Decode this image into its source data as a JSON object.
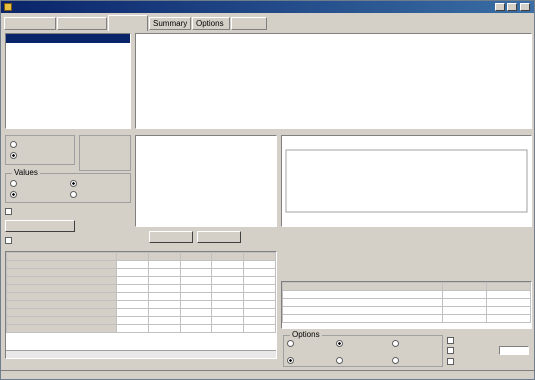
{
  "window": {
    "title": ""
  },
  "tabs": [
    {
      "label": ""
    },
    {
      "label": ""
    },
    {
      "label": ""
    },
    {
      "label": "Summary"
    },
    {
      "label": "Options"
    },
    {
      "label": ""
    }
  ],
  "person_list": [
    {
      "label": "",
      "selected": true
    },
    {
      "label": ""
    },
    {
      "label": ""
    },
    {
      "label": ""
    },
    {
      "label": ""
    },
    {
      "label": ""
    },
    {
      "label": ""
    },
    {
      "label": ""
    }
  ],
  "paragraphs": [
    "",
    "",
    "",
    "",
    "",
    "",
    "",
    "",
    "",
    "",
    "",
    "",
    "",
    "",
    "",
    ""
  ],
  "source_group": {
    "title": "",
    "option_a": "",
    "option_b": "",
    "option_b_selected": true
  },
  "data_group": {
    "title": "",
    "items": [
      "",
      "",
      "",
      ""
    ]
  },
  "results_group": {
    "title": "Values",
    "summary": "",
    "average": "",
    "average_selected": true,
    "all_data": "",
    "all_data_selected": true,
    "not_empty": ""
  },
  "percent_check": {
    "label": ""
  },
  "query_button": {
    "label": ""
  },
  "all_check": {
    "label": ""
  },
  "small_list": [
    "",
    ""
  ],
  "chart": {
    "title": "",
    "accent": "#ff0000",
    "background": "#ffffff"
  },
  "chart_data": {
    "type": "bar",
    "title": "",
    "values": [],
    "overlay_series": [],
    "xlabel": "",
    "ylabel": ""
  },
  "left_table": {
    "headers": [
      "",
      "",
      "",
      "",
      "",
      ""
    ],
    "rows": [
      {
        "label": "",
        "values": [
          "",
          "",
          "",
          "",
          ""
        ]
      },
      {
        "label": "",
        "values": [
          "",
          "",
          "",
          "",
          ""
        ]
      },
      {
        "label": "",
        "values": [
          "",
          "",
          "",
          "",
          ""
        ]
      },
      {
        "label": "",
        "values": [
          "",
          "",
          "",
          "",
          ""
        ]
      },
      {
        "label": "",
        "values": [
          "",
          "",
          "",
          "",
          ""
        ]
      },
      {
        "label": "",
        "values": [
          "",
          "",
          "",
          "",
          ""
        ]
      },
      {
        "label": "",
        "values": [
          "",
          "",
          "",
          "",
          ""
        ]
      },
      {
        "label": "",
        "values": [
          "",
          "",
          "",
          "",
          ""
        ]
      }
    ],
    "total_row": {
      "label": "",
      "values": [
        "",
        "",
        "",
        "",
        ""
      ]
    }
  },
  "summary_heading": "",
  "right_table": {
    "headers": [
      "",
      "",
      ""
    ],
    "rows": [
      {
        "label": "",
        "value": "",
        "extra": ""
      },
      {
        "label": "",
        "value": "",
        "extra": ""
      },
      {
        "label": "",
        "value": "",
        "extra": ""
      },
      {
        "label": "",
        "value": "",
        "extra": ""
      }
    ]
  },
  "options_group": {
    "title": "Options",
    "radio_a": "",
    "radio_b": "",
    "radio_b_selected": true,
    "radio_c": "",
    "classif_title": "",
    "class_a": "",
    "class_a_selected": true,
    "class_b": "",
    "class_c": "",
    "check_a": "",
    "check_b": "",
    "check_c": "",
    "field_value": ""
  },
  "status_bar": ""
}
